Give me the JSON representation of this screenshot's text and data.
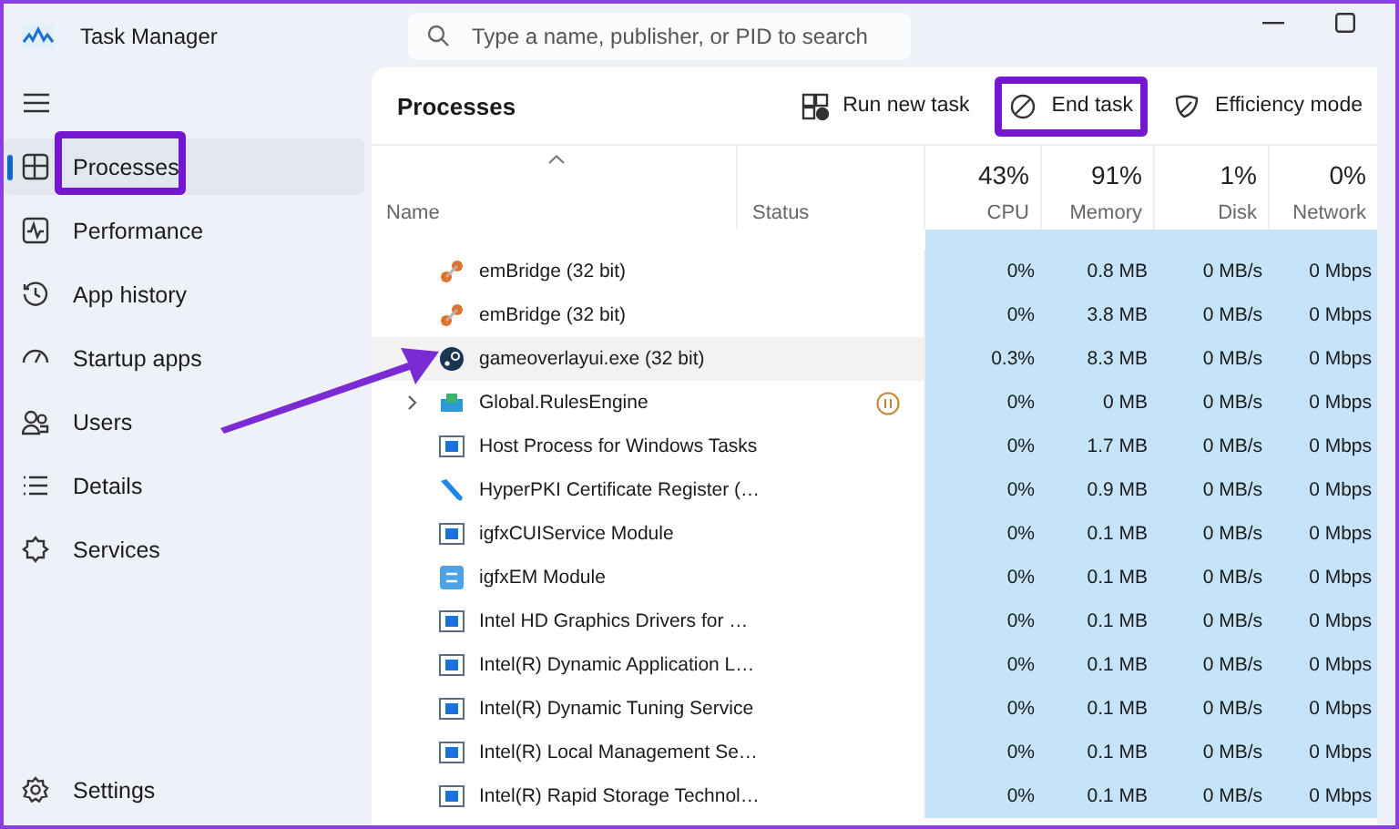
{
  "window": {
    "title": "Task Manager"
  },
  "search": {
    "placeholder": "Type a name, publisher, or PID to search"
  },
  "sidebar": {
    "items": [
      {
        "label": "Processes",
        "selected": true,
        "highlighted": true
      },
      {
        "label": "Performance",
        "selected": false,
        "highlighted": false
      },
      {
        "label": "App history",
        "selected": false,
        "highlighted": false
      },
      {
        "label": "Startup apps",
        "selected": false,
        "highlighted": false
      },
      {
        "label": "Users",
        "selected": false,
        "highlighted": false
      },
      {
        "label": "Details",
        "selected": false,
        "highlighted": false
      },
      {
        "label": "Services",
        "selected": false,
        "highlighted": false
      }
    ],
    "footer": {
      "label": "Settings"
    }
  },
  "page": {
    "title": "Processes",
    "toolbar": [
      {
        "label": "Run new task",
        "highlighted": false
      },
      {
        "label": "End task",
        "highlighted": true
      },
      {
        "label": "Efficiency mode",
        "highlighted": false
      }
    ]
  },
  "table": {
    "columns": [
      {
        "label": "Name"
      },
      {
        "label": "Status"
      },
      {
        "percent": "43%",
        "label": "CPU"
      },
      {
        "percent": "91%",
        "label": "Memory"
      },
      {
        "percent": "1%",
        "label": "Disk"
      },
      {
        "percent": "0%",
        "label": "Network"
      }
    ],
    "rows": [
      {
        "name": "emBridge (32 bit)",
        "kind": "dots",
        "expandable": false,
        "suspended": false,
        "selected": false,
        "cpu": "0%",
        "memory": "0.8 MB",
        "disk": "0 MB/s",
        "network": "0 Mbps"
      },
      {
        "name": "emBridge (32 bit)",
        "kind": "dots",
        "expandable": false,
        "suspended": false,
        "selected": false,
        "cpu": "0%",
        "memory": "3.8 MB",
        "disk": "0 MB/s",
        "network": "0 Mbps"
      },
      {
        "name": "gameoverlayui.exe (32 bit)",
        "kind": "round",
        "expandable": false,
        "suspended": false,
        "selected": true,
        "cpu": "0.3%",
        "memory": "8.3 MB",
        "disk": "0 MB/s",
        "network": "0 Mbps"
      },
      {
        "name": "Global.RulesEngine",
        "kind": "package",
        "expandable": true,
        "suspended": true,
        "selected": false,
        "cpu": "0%",
        "memory": "0 MB",
        "disk": "0 MB/s",
        "network": "0 Mbps"
      },
      {
        "name": "Host Process for Windows Tasks",
        "kind": "window",
        "expandable": false,
        "suspended": false,
        "selected": false,
        "cpu": "0%",
        "memory": "1.7 MB",
        "disk": "0 MB/s",
        "network": "0 Mbps"
      },
      {
        "name": "HyperPKI Certificate Register (…",
        "kind": "pen",
        "expandable": false,
        "suspended": false,
        "selected": false,
        "cpu": "0%",
        "memory": "0.9 MB",
        "disk": "0 MB/s",
        "network": "0 Mbps"
      },
      {
        "name": "igfxCUIService Module",
        "kind": "window",
        "expandable": false,
        "suspended": false,
        "selected": false,
        "cpu": "0%",
        "memory": "0.1 MB",
        "disk": "0 MB/s",
        "network": "0 Mbps"
      },
      {
        "name": "igfxEM Module",
        "kind": "tile",
        "expandable": false,
        "suspended": false,
        "selected": false,
        "cpu": "0%",
        "memory": "0.1 MB",
        "disk": "0 MB/s",
        "network": "0 Mbps"
      },
      {
        "name": "Intel HD Graphics Drivers for …",
        "kind": "window",
        "expandable": false,
        "suspended": false,
        "selected": false,
        "cpu": "0%",
        "memory": "0.1 MB",
        "disk": "0 MB/s",
        "network": "0 Mbps"
      },
      {
        "name": "Intel(R) Dynamic Application L…",
        "kind": "window",
        "expandable": false,
        "suspended": false,
        "selected": false,
        "cpu": "0%",
        "memory": "0.1 MB",
        "disk": "0 MB/s",
        "network": "0 Mbps"
      },
      {
        "name": "Intel(R) Dynamic Tuning Service",
        "kind": "window",
        "expandable": false,
        "suspended": false,
        "selected": false,
        "cpu": "0%",
        "memory": "0.1 MB",
        "disk": "0 MB/s",
        "network": "0 Mbps"
      },
      {
        "name": "Intel(R) Local Management Se…",
        "kind": "window",
        "expandable": false,
        "suspended": false,
        "selected": false,
        "cpu": "0%",
        "memory": "0.1 MB",
        "disk": "0 MB/s",
        "network": "0 Mbps"
      },
      {
        "name": "Intel(R) Rapid Storage Technol…",
        "kind": "window",
        "expandable": false,
        "suspended": false,
        "selected": false,
        "cpu": "0%",
        "memory": "0.1 MB",
        "disk": "0 MB/s",
        "network": "0 Mbps"
      }
    ]
  }
}
